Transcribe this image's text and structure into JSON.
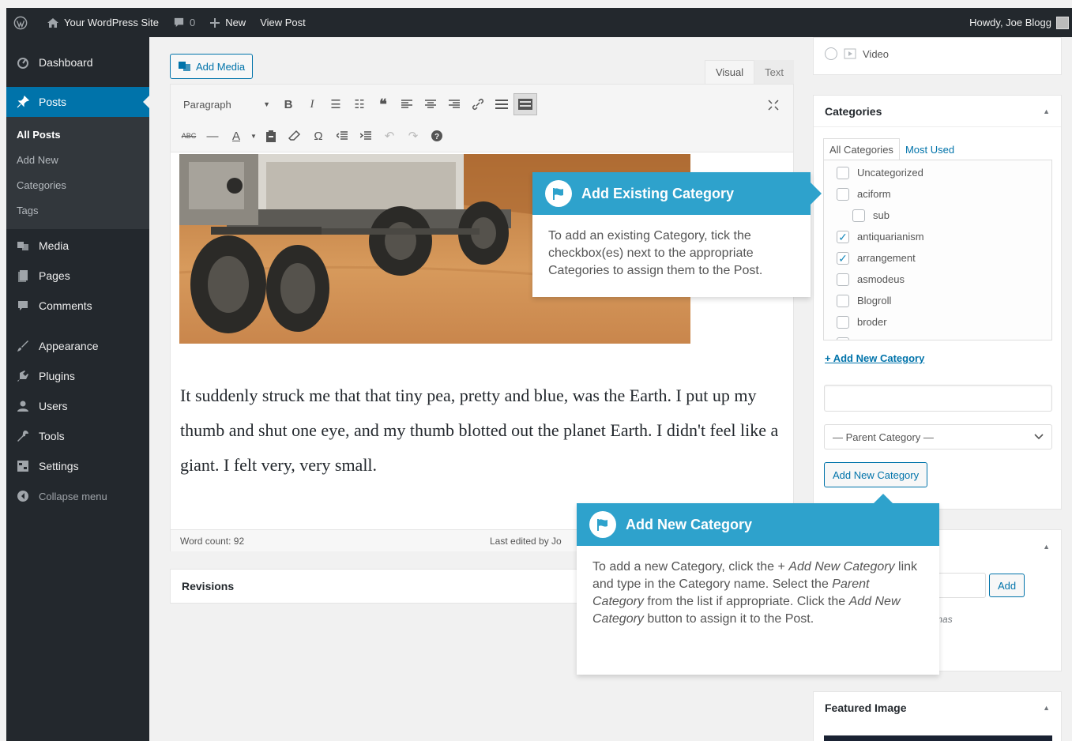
{
  "admin_bar": {
    "site_name": "Your WordPress Site",
    "comments_count": "0",
    "new_label": "New",
    "view_post_label": "View Post",
    "howdy": "Howdy, Joe Blogg"
  },
  "sidebar": {
    "dashboard": "Dashboard",
    "posts": "Posts",
    "posts_sub": [
      "All Posts",
      "Add New",
      "Categories",
      "Tags"
    ],
    "media": "Media",
    "pages": "Pages",
    "comments": "Comments",
    "appearance": "Appearance",
    "plugins": "Plugins",
    "users": "Users",
    "tools": "Tools",
    "settings": "Settings",
    "collapse": "Collapse menu"
  },
  "editor": {
    "add_media": "Add Media",
    "tab_visual": "Visual",
    "tab_text": "Text",
    "format_select": "Paragraph",
    "body_text": "It suddenly struck me that that tiny pea, pretty and blue, was the Earth. I put up my thumb and shut one eye, and my thumb blotted out the planet Earth. I didn't feel like a giant. I felt very, very small.",
    "word_count": "Word count: 92",
    "last_edited": "Last edited by Jo"
  },
  "revisions": {
    "title": "Revisions"
  },
  "format_box": {
    "video_label": "Video"
  },
  "categories": {
    "title": "Categories",
    "tab_all": "All Categories",
    "tab_most_used": "Most Used",
    "items": [
      {
        "label": "Uncategorized",
        "checked": false
      },
      {
        "label": "aciform",
        "checked": false
      },
      {
        "label": "sub",
        "checked": false
      },
      {
        "label": "antiquarianism",
        "checked": true
      },
      {
        "label": "arrangement",
        "checked": true
      },
      {
        "label": "asmodeus",
        "checked": false
      },
      {
        "label": "Blogroll",
        "checked": false
      },
      {
        "label": "broder",
        "checked": false
      }
    ],
    "add_new_link": "+ Add New Category",
    "parent_select": "— Parent Category —",
    "add_new_button": "Add New Category"
  },
  "tags": {
    "add_button": "Add",
    "hint_fragment": "mmas"
  },
  "featured_image": {
    "title": "Featured Image"
  },
  "pointer_existing": {
    "title": "Add Existing Category",
    "body": "To add an existing Category, tick the checkbox(es) next to the appropriate Categories to assign them to the Post."
  },
  "pointer_new": {
    "title": "Add New Category",
    "body_p1": "To add a new Category, click the + ",
    "body_em1": "Add New Category",
    "body_p2": " link and type in the Category name. Select the ",
    "body_em2": "Parent Category",
    "body_p3": " from the list if appropriate. Click the ",
    "body_em3": "Add New Category",
    "body_p4": " button to assign it to the Post."
  },
  "colors": {
    "admin_dark": "#23282d",
    "accent_blue": "#0073aa",
    "pointer_blue": "#2ea2cc",
    "background": "#f1f1f1"
  }
}
